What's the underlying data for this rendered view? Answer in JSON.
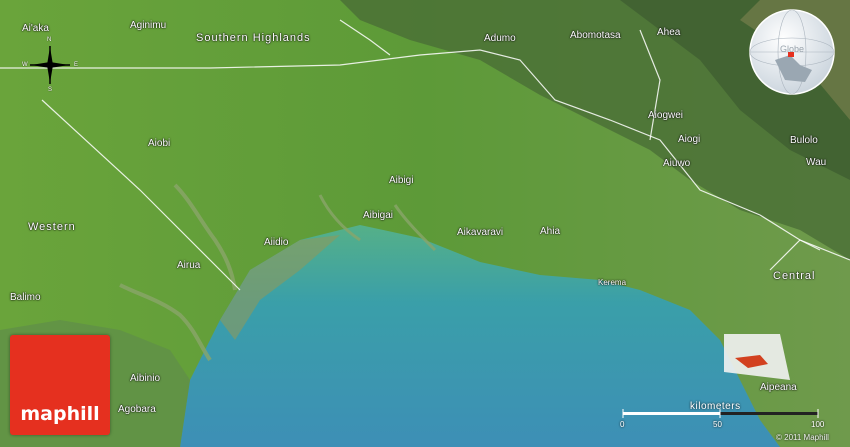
{
  "map": {
    "regions": {
      "southern_highlands": "Southern Highlands",
      "western": "Western",
      "central": "Central"
    },
    "places": {
      "aiaka": "Ai'aka",
      "aginimu": "Aginimu",
      "adumo": "Adumo",
      "abomotasa": "Abomotasa",
      "ahea": "Ahea",
      "aiobi": "Aiobi",
      "aiogwei": "Aiogwei",
      "aiogi": "Aiogi",
      "aiuwo": "Aiuwo",
      "bulolo": "Bulolo",
      "wau": "Wau",
      "aibigi": "Aibigi",
      "aibigai": "Aibigai",
      "aiidio": "Aiidio",
      "aikavaravi": "Aikavaravi",
      "ahia": "Ahia",
      "airua": "Airua",
      "kerema": "Kerema",
      "balimo": "Balimo",
      "aibinio": "Aibinio",
      "agobara": "Agobara",
      "aipeana": "Aipeana"
    },
    "compass": {
      "n": "N",
      "s": "S",
      "e": "E",
      "w": "W"
    },
    "globe_label": "Globe",
    "scale": {
      "label": "kilometers",
      "ticks": [
        "0",
        "50",
        "100"
      ]
    },
    "logo": "maphill",
    "copyright": "© 2011 Maphill",
    "colors": {
      "land": "#5f9a3a",
      "highlands": "#4d6e3b",
      "sea": "#2f8fa8",
      "coastal_water": "#3fa6a0",
      "border": "#ffffff",
      "logo": "#e5301f"
    }
  }
}
